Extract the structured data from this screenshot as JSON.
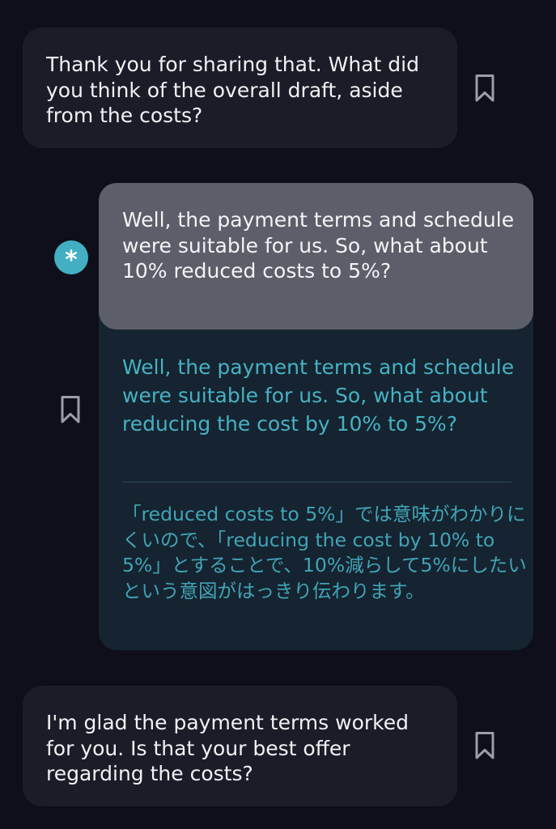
{
  "messages": [
    {
      "role": "assistant",
      "text": "Thank you for sharing that. What did you think of the overall draft, aside from the costs?",
      "icon": "bookmark-icon"
    },
    {
      "role": "user",
      "avatar_glyph": "*",
      "original_text": "Well, the payment terms and schedule were suitable for us. So, what about 10% reduced costs to 5%?",
      "corrected_text": "Well, the payment terms and schedule were suitable for us. So, what about reducing the cost by 10% to 5%?",
      "explanation": "「reduced costs to 5%」では意味がわかりにくいので、「reducing the cost by 10% to 5%」とすることで、10%減らして5%にしたいという意図がはっきり伝わります。",
      "icon": "bookmark-icon"
    },
    {
      "role": "assistant",
      "text": "I'm glad the payment terms worked for you. Is that your best offer regarding the costs?",
      "icon": "bookmark-icon"
    }
  ],
  "colors": {
    "background": "#0e0f1a",
    "assistant_bubble": "#1a1d28",
    "user_bubble": "#5c5f69",
    "correction_panel": "#152430",
    "accent": "#42afc2"
  }
}
